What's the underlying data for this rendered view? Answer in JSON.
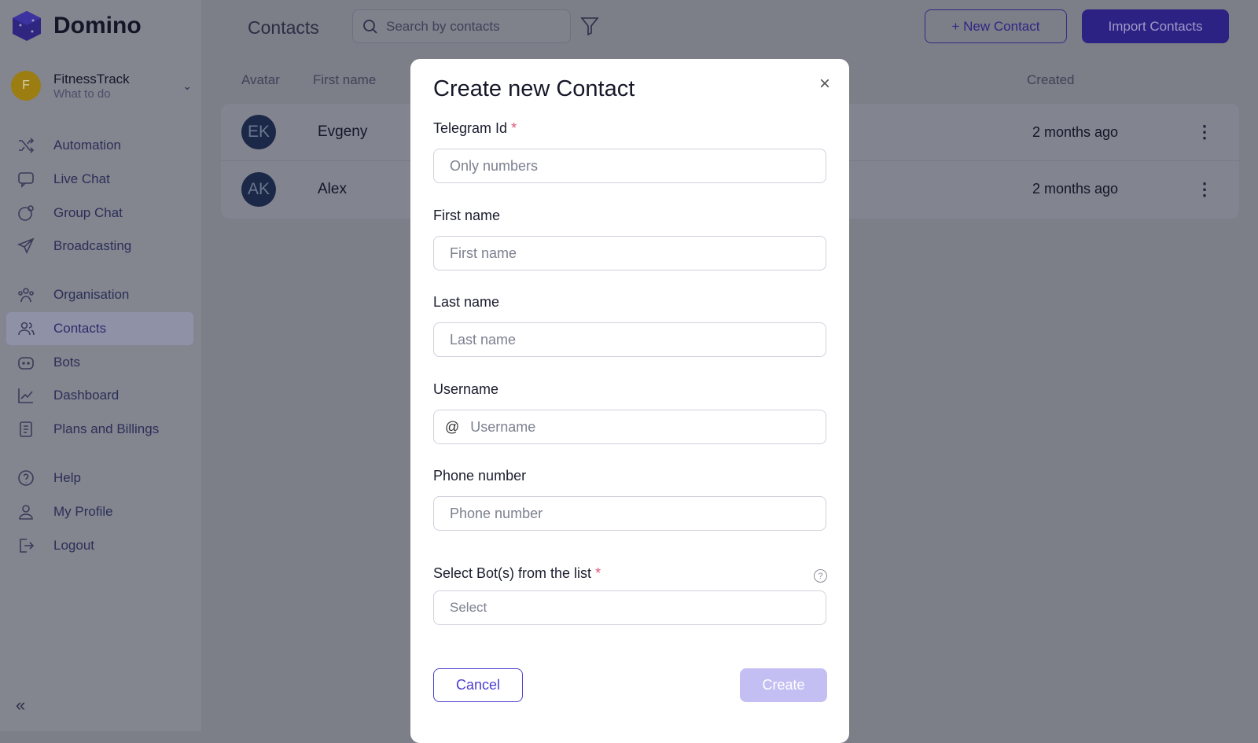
{
  "brand": {
    "name": "Domino",
    "color": "#3b2f9f"
  },
  "workspace": {
    "initial": "F",
    "name": "FitnessTrack",
    "subtitle": "What to do"
  },
  "sidebar": {
    "items": [
      {
        "label": "Automation",
        "icon": "shuffle-icon"
      },
      {
        "label": "Live Chat",
        "icon": "chat-icon"
      },
      {
        "label": "Group Chat",
        "icon": "group-chat-icon"
      },
      {
        "label": "Broadcasting",
        "icon": "send-icon"
      },
      {
        "label": "Organisation",
        "icon": "organisation-icon"
      },
      {
        "label": "Contacts",
        "icon": "contacts-icon",
        "active": true
      },
      {
        "label": "Bots",
        "icon": "bot-icon"
      },
      {
        "label": "Dashboard",
        "icon": "chart-icon"
      },
      {
        "label": "Plans and Billings",
        "icon": "billing-icon"
      },
      {
        "label": "Help",
        "icon": "help-icon"
      },
      {
        "label": "My Profile",
        "icon": "user-icon"
      },
      {
        "label": "Logout",
        "icon": "logout-icon"
      }
    ],
    "collapse": "«"
  },
  "header": {
    "title": "Contacts",
    "search_placeholder": "Search by contacts",
    "new_contact": "+ New Contact",
    "import_contacts": "Import Contacts"
  },
  "table": {
    "columns": [
      "Avatar",
      "First name",
      "Created"
    ],
    "rows": [
      {
        "initials": "EK",
        "first_name": "Evgeny",
        "created": "2 months ago"
      },
      {
        "initials": "AK",
        "first_name": "Alex",
        "created": "2 months ago"
      }
    ]
  },
  "modal": {
    "title": "Create new Contact",
    "close": "×",
    "fields": [
      {
        "label": "Telegram Id",
        "required": true,
        "placeholder": "Only numbers"
      },
      {
        "label": "First name",
        "placeholder": "First name"
      },
      {
        "label": "Last name",
        "placeholder": "Last name"
      },
      {
        "label": "Username",
        "prefix": "@",
        "placeholder": "Username"
      },
      {
        "label": "Phone number",
        "placeholder": "Phone number"
      }
    ],
    "bots": {
      "label": "Select Bot(s) from the list",
      "required": true,
      "placeholder": "Select",
      "help": "?"
    },
    "cancel": "Cancel",
    "create": "Create",
    "required_mark": "*"
  }
}
